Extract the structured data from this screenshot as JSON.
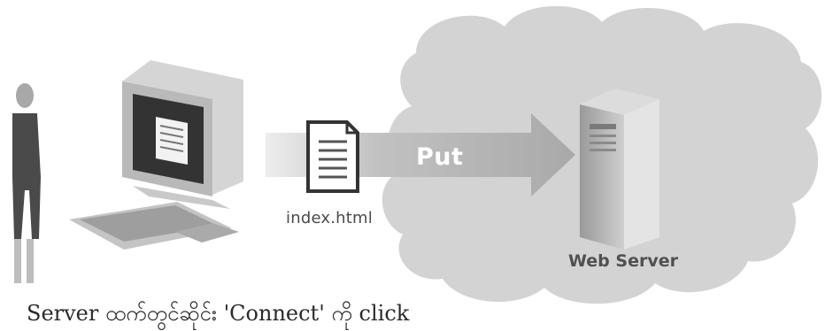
{
  "diagram": {
    "file_label": "index.html",
    "arrow_label": "Put",
    "server_label": "Web Server"
  },
  "caption": {
    "text": "Server ထက်တွင်ဆိုင်း 'Connect' ကို click"
  },
  "icons": {
    "person": "person-icon",
    "computer": "computer-icon",
    "document": "document-icon",
    "server": "server-icon",
    "cloud": "cloud-icon",
    "arrow": "arrow-icon"
  },
  "colors": {
    "cloud_fill": "#d6d6d6",
    "arrow_fill": "#b8b8b8",
    "monitor_dark": "#3a3a3a"
  }
}
